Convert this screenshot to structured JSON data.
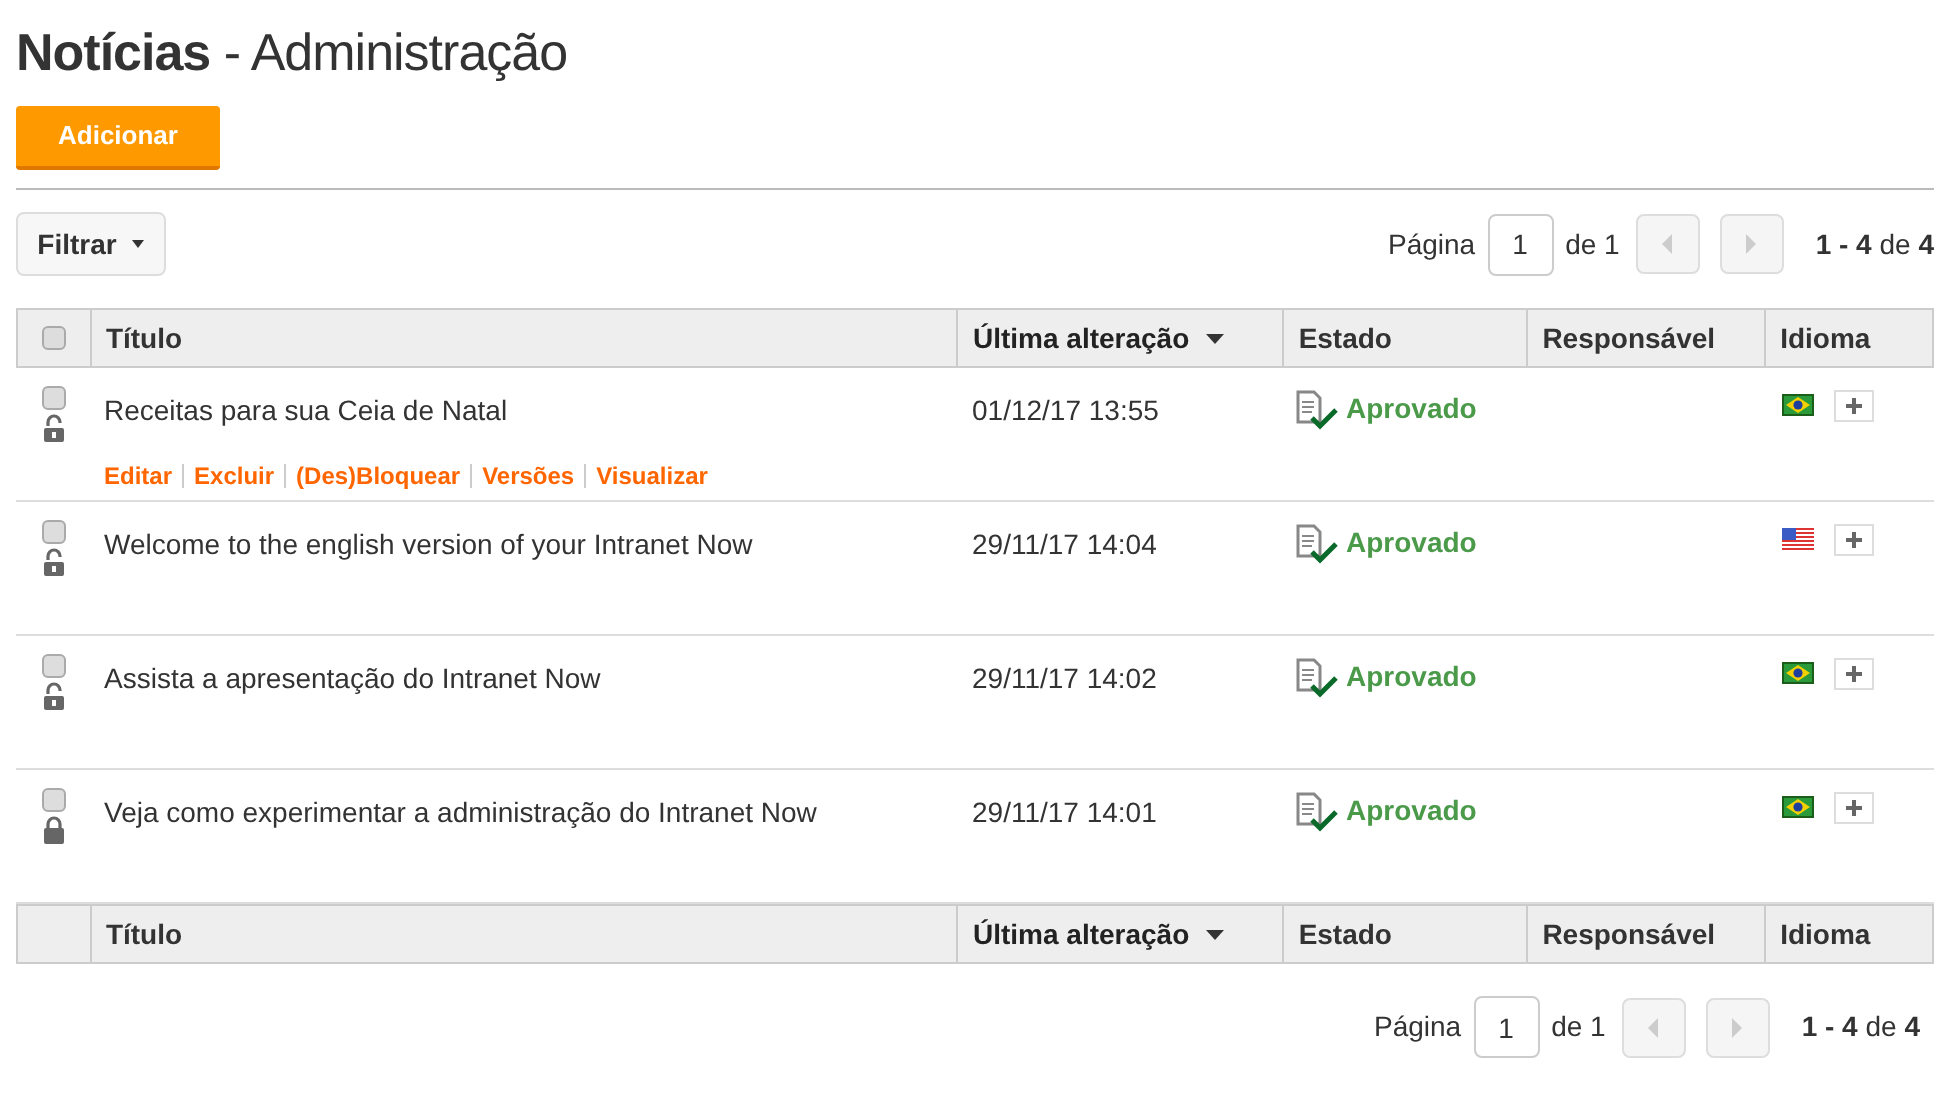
{
  "title": {
    "main": "Notícias",
    "sub": "- Administração"
  },
  "add_button": "Adicionar",
  "filter_button": "Filtrar",
  "pagination_top": {
    "label": "Página",
    "page": "1",
    "of": "de 1",
    "range": "1 - 4",
    "range_of": "de",
    "total": "4"
  },
  "table": {
    "select_all": {
      "checked": false
    },
    "columns": [
      {
        "label": "Título",
        "sorted": false
      },
      {
        "label": "Última alteração",
        "sorted": true
      },
      {
        "label": "Estado",
        "sorted": false
      },
      {
        "label": "Responsável",
        "sorted": false
      },
      {
        "label": "Idioma",
        "sorted": false
      }
    ],
    "rows": [
      {
        "checked": false,
        "locked": false,
        "title": "Receitas para sua Ceia de Natal",
        "date": "01/12/17 13:55",
        "status": "Aprovado",
        "language": {
          "kind": "br"
        },
        "actions": [
          "Editar",
          "Excluir",
          "(Des)Bloquear",
          "Versões",
          "Visualizar"
        ]
      },
      {
        "checked": false,
        "locked": false,
        "title": "Welcome to the english version of your Intranet Now",
        "date": "29/11/17 14:04",
        "status": "Aprovado",
        "language": {
          "kind": "us"
        }
      },
      {
        "checked": false,
        "locked": false,
        "title": "Assista a apresentação do Intranet Now",
        "date": "29/11/17 14:02",
        "status": "Aprovado",
        "language": {
          "kind": "br"
        }
      },
      {
        "checked": false,
        "locked": true,
        "title": "Veja como experimentar a administração do Intranet Now",
        "date": "29/11/17 14:01",
        "status": "Aprovado",
        "language": {
          "kind": "br"
        }
      }
    ],
    "footer_columns": [
      {
        "label": "Título",
        "sorted": false
      },
      {
        "label": "Última alteração",
        "sorted": true
      },
      {
        "label": "Estado",
        "sorted": false
      },
      {
        "label": "Responsável",
        "sorted": false
      },
      {
        "label": "Idioma",
        "sorted": false
      }
    ]
  },
  "pagination_bottom": {
    "label": "Página",
    "page": "1",
    "of": "de 1",
    "range": "1 - 4",
    "range_of": "de",
    "total": "4"
  }
}
